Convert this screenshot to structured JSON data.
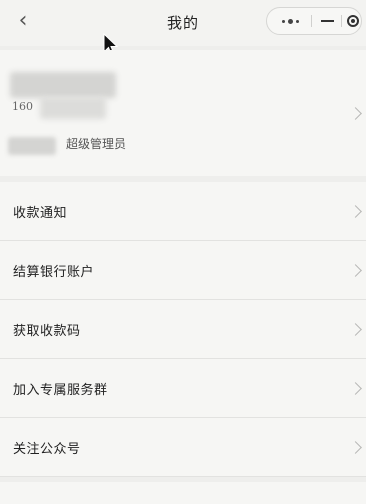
{
  "nav": {
    "title": "我的",
    "back_icon": "chevron-left-icon",
    "capsule": {
      "more_icon": "more-dots-icon",
      "minimize_icon": "minimize-icon",
      "close_icon": "circle-close-icon"
    }
  },
  "profile": {
    "phone_prefix": "160",
    "role": "超级管理员",
    "chevron_icon": "chevron-right-icon"
  },
  "menu": {
    "items": [
      {
        "label": "收款通知"
      },
      {
        "label": "结算银行账户"
      },
      {
        "label": "获取收款码"
      },
      {
        "label": "加入专属服务群"
      },
      {
        "label": "关注公众号"
      }
    ]
  }
}
